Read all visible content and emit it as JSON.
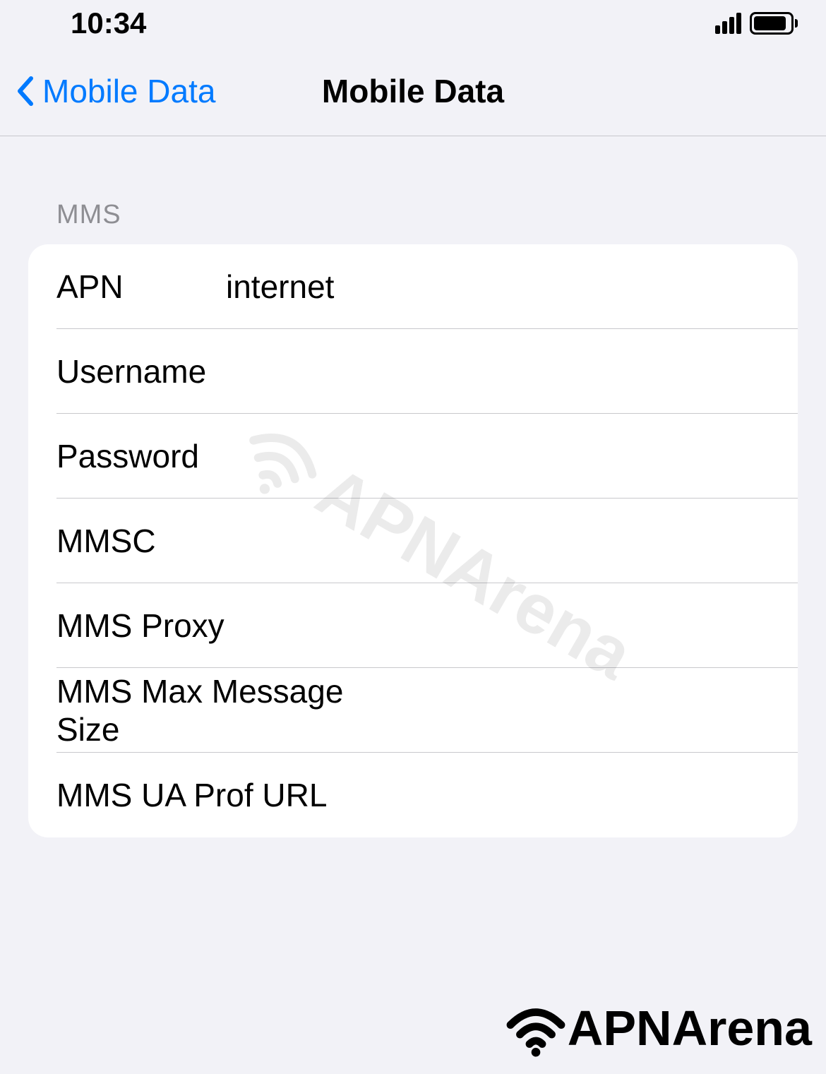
{
  "status_bar": {
    "time": "10:34"
  },
  "nav": {
    "back_label": "Mobile Data",
    "title": "Mobile Data"
  },
  "section": {
    "header": "MMS"
  },
  "fields": {
    "apn": {
      "label": "APN",
      "value": "internet"
    },
    "username": {
      "label": "Username",
      "value": ""
    },
    "password": {
      "label": "Password",
      "value": ""
    },
    "mmsc": {
      "label": "MMSC",
      "value": ""
    },
    "mms_proxy": {
      "label": "MMS Proxy",
      "value": ""
    },
    "mms_max_size": {
      "label": "MMS Max Message Size",
      "value": ""
    },
    "mms_ua_prof": {
      "label": "MMS UA Prof URL",
      "value": ""
    }
  },
  "watermark": {
    "text": "APNArena"
  }
}
